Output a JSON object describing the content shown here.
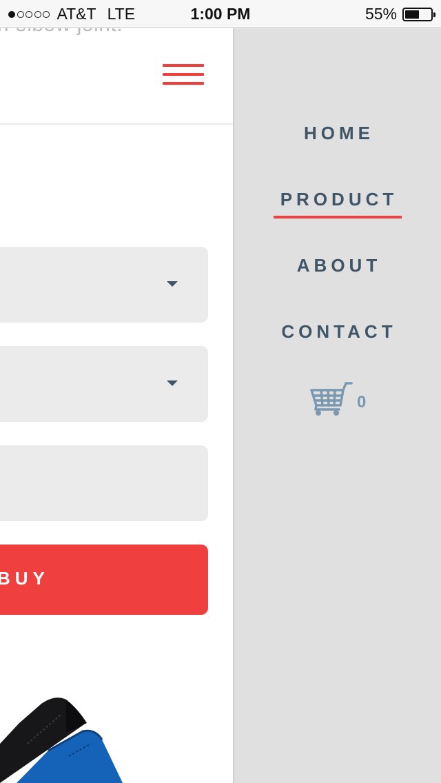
{
  "status_bar": {
    "carrier": "AT&T",
    "network": "LTE",
    "time": "1:00 PM",
    "battery_percent": "55%",
    "battery_level": 0.55,
    "signal_bars_filled": 1,
    "signal_bars_total": 5
  },
  "content": {
    "clipped_text": "n elbow joint.",
    "buy_label": "BUY"
  },
  "menu": {
    "items": [
      {
        "label": "HOME",
        "active": false
      },
      {
        "label": "PRODUCT",
        "active": true
      },
      {
        "label": "ABOUT",
        "active": false
      },
      {
        "label": "CONTACT",
        "active": false
      }
    ],
    "cart_count": "0"
  },
  "colors": {
    "accent": "#ef3f3f",
    "menu_text": "#3f5566",
    "menu_bg": "#e0e0e0",
    "input_bg": "#ebebeb",
    "cart": "#7a98b0"
  },
  "icons": [
    "hamburger-icon",
    "caret-down-icon",
    "cart-icon",
    "battery-icon",
    "signal-icon"
  ]
}
